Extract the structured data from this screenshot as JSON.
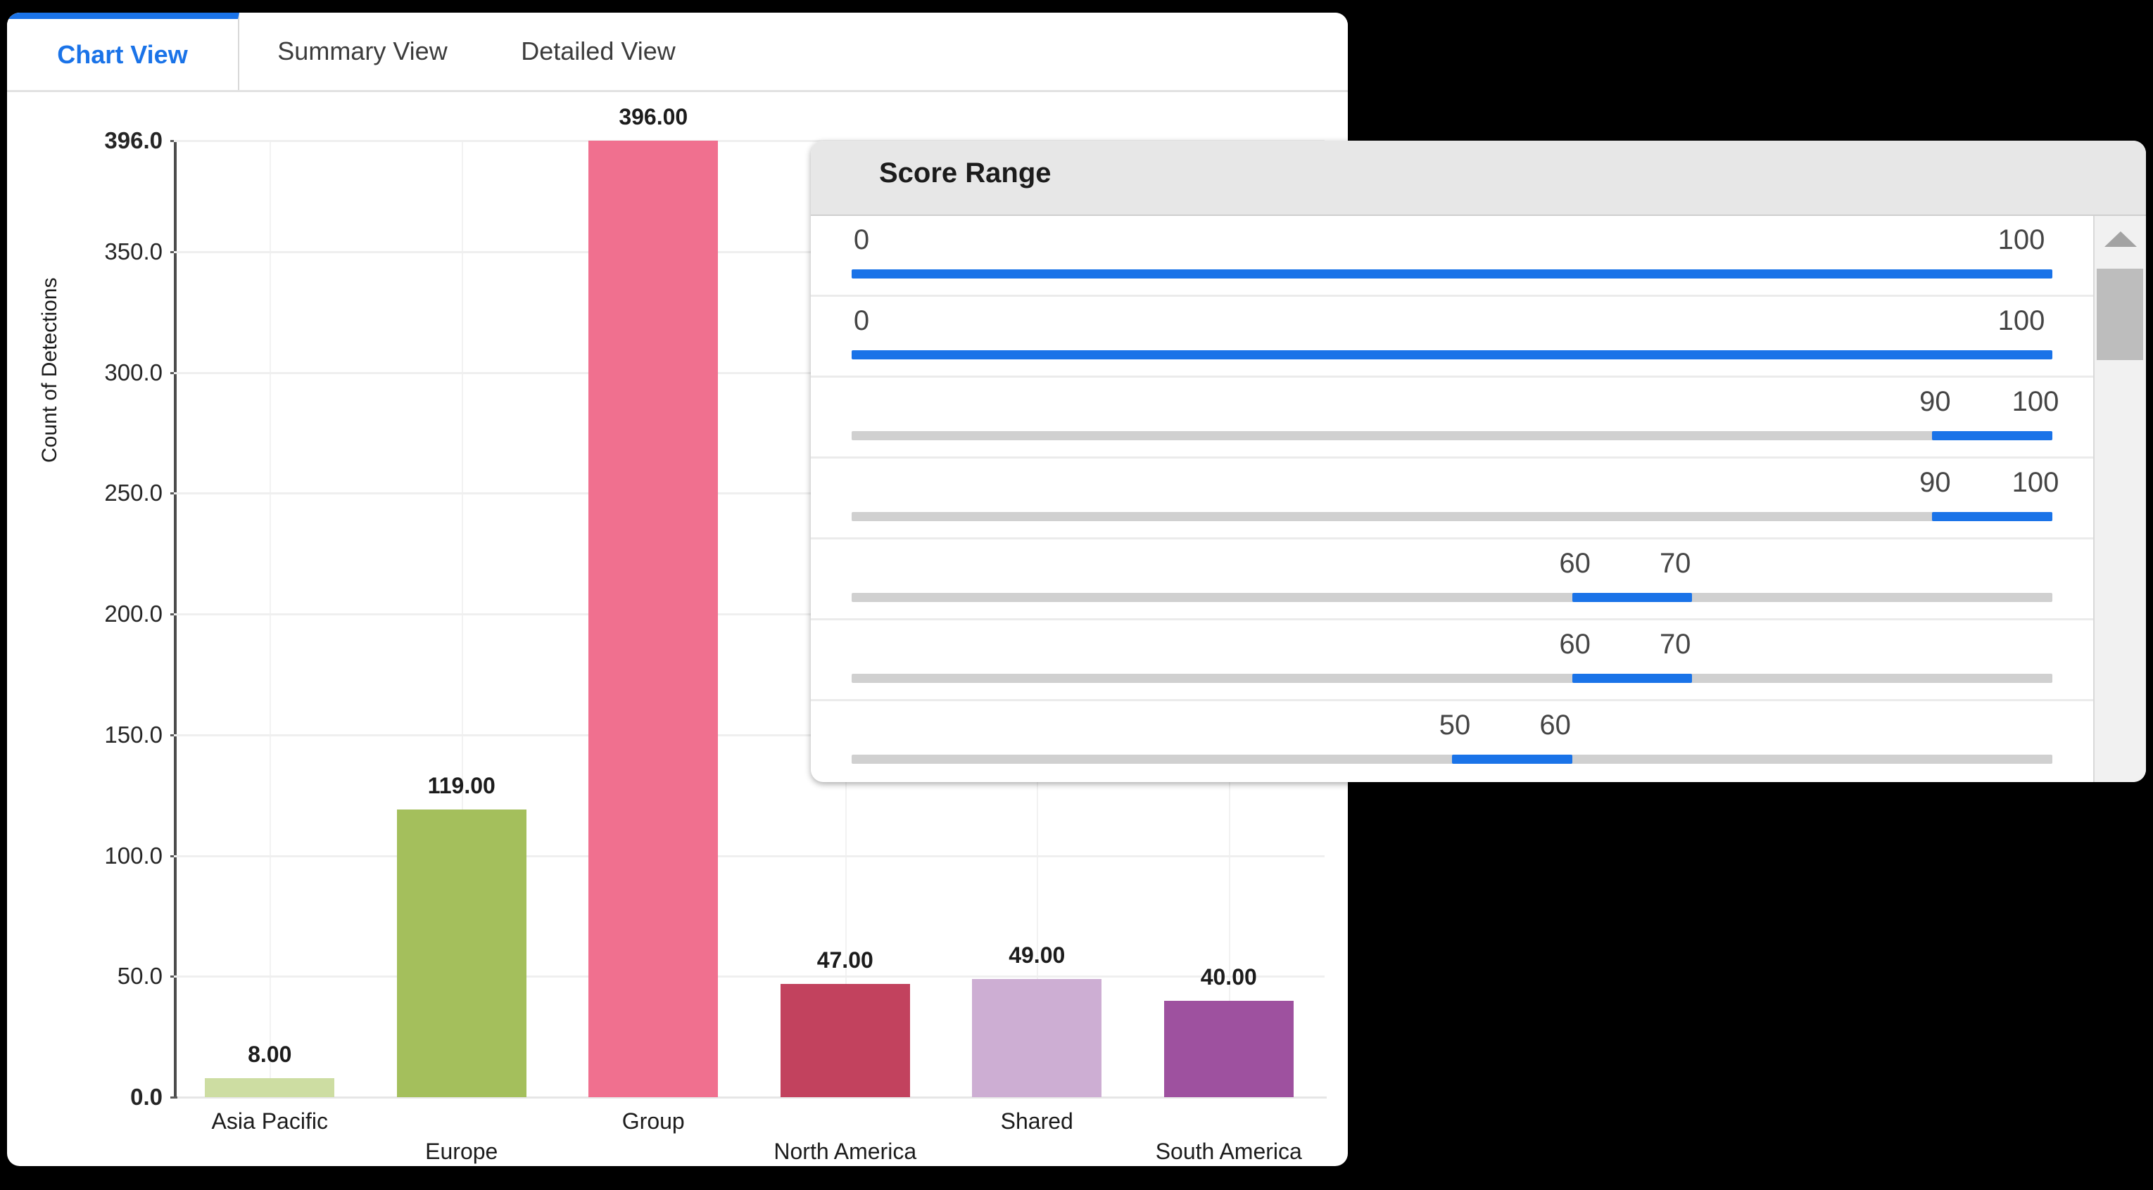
{
  "tabs": [
    {
      "label": "Chart View",
      "active": true
    },
    {
      "label": "Summary View",
      "active": false
    },
    {
      "label": "Detailed View",
      "active": false
    }
  ],
  "colors": {
    "accent": "#1a73e8",
    "tab_text": "#3c3c3c",
    "slider_fill": "#1a73e8",
    "slider_track": "#d0d0d0",
    "panel_header": "#e7e7e7"
  },
  "chart_data": {
    "type": "bar",
    "title": "",
    "xlabel": "",
    "ylabel": "Count of Detections",
    "categories": [
      "Asia Pacific",
      "Europe",
      "Group",
      "North America",
      "Shared",
      "South America"
    ],
    "values": [
      8,
      119,
      396,
      47,
      49,
      40
    ],
    "value_labels": [
      "8.00",
      "119.00",
      "396.00",
      "47.00",
      "49.00",
      "40.00"
    ],
    "bar_colors": [
      "#cddda2",
      "#a4bf5c",
      "#f0708f",
      "#c2425e",
      "#cdaed3",
      "#9e519f"
    ],
    "ylim": [
      0,
      396
    ],
    "yticks": [
      0,
      50,
      100,
      150,
      200,
      250,
      300,
      350,
      396
    ],
    "ytick_labels": [
      "0.0",
      "50.0",
      "100.0",
      "150.0",
      "200.0",
      "250.0",
      "300.0",
      "350.0",
      "396.0"
    ],
    "ytick_bold": [
      true,
      false,
      false,
      false,
      false,
      false,
      false,
      false,
      true
    ],
    "grid": true,
    "legend": "none"
  },
  "score_panel": {
    "title": "Score Range",
    "scale_min": 0,
    "scale_max": 100,
    "rows": [
      {
        "min": 0,
        "max": 100,
        "min_label": "0",
        "max_label": "100",
        "full": true
      },
      {
        "min": 0,
        "max": 100,
        "min_label": "0",
        "max_label": "100",
        "full": true
      },
      {
        "min": 90,
        "max": 100,
        "min_label": "90",
        "max_label": "100",
        "full": false
      },
      {
        "min": 90,
        "max": 100,
        "min_label": "90",
        "max_label": "100",
        "full": false
      },
      {
        "min": 60,
        "max": 70,
        "min_label": "60",
        "max_label": "70",
        "full": false
      },
      {
        "min": 60,
        "max": 70,
        "min_label": "60",
        "max_label": "70",
        "full": false
      },
      {
        "min": 50,
        "max": 60,
        "min_label": "50",
        "max_label": "60",
        "full": false
      }
    ],
    "scrollbar": {
      "up_arrow": "scroll-up-arrow",
      "thumb_position": "near-top"
    }
  }
}
